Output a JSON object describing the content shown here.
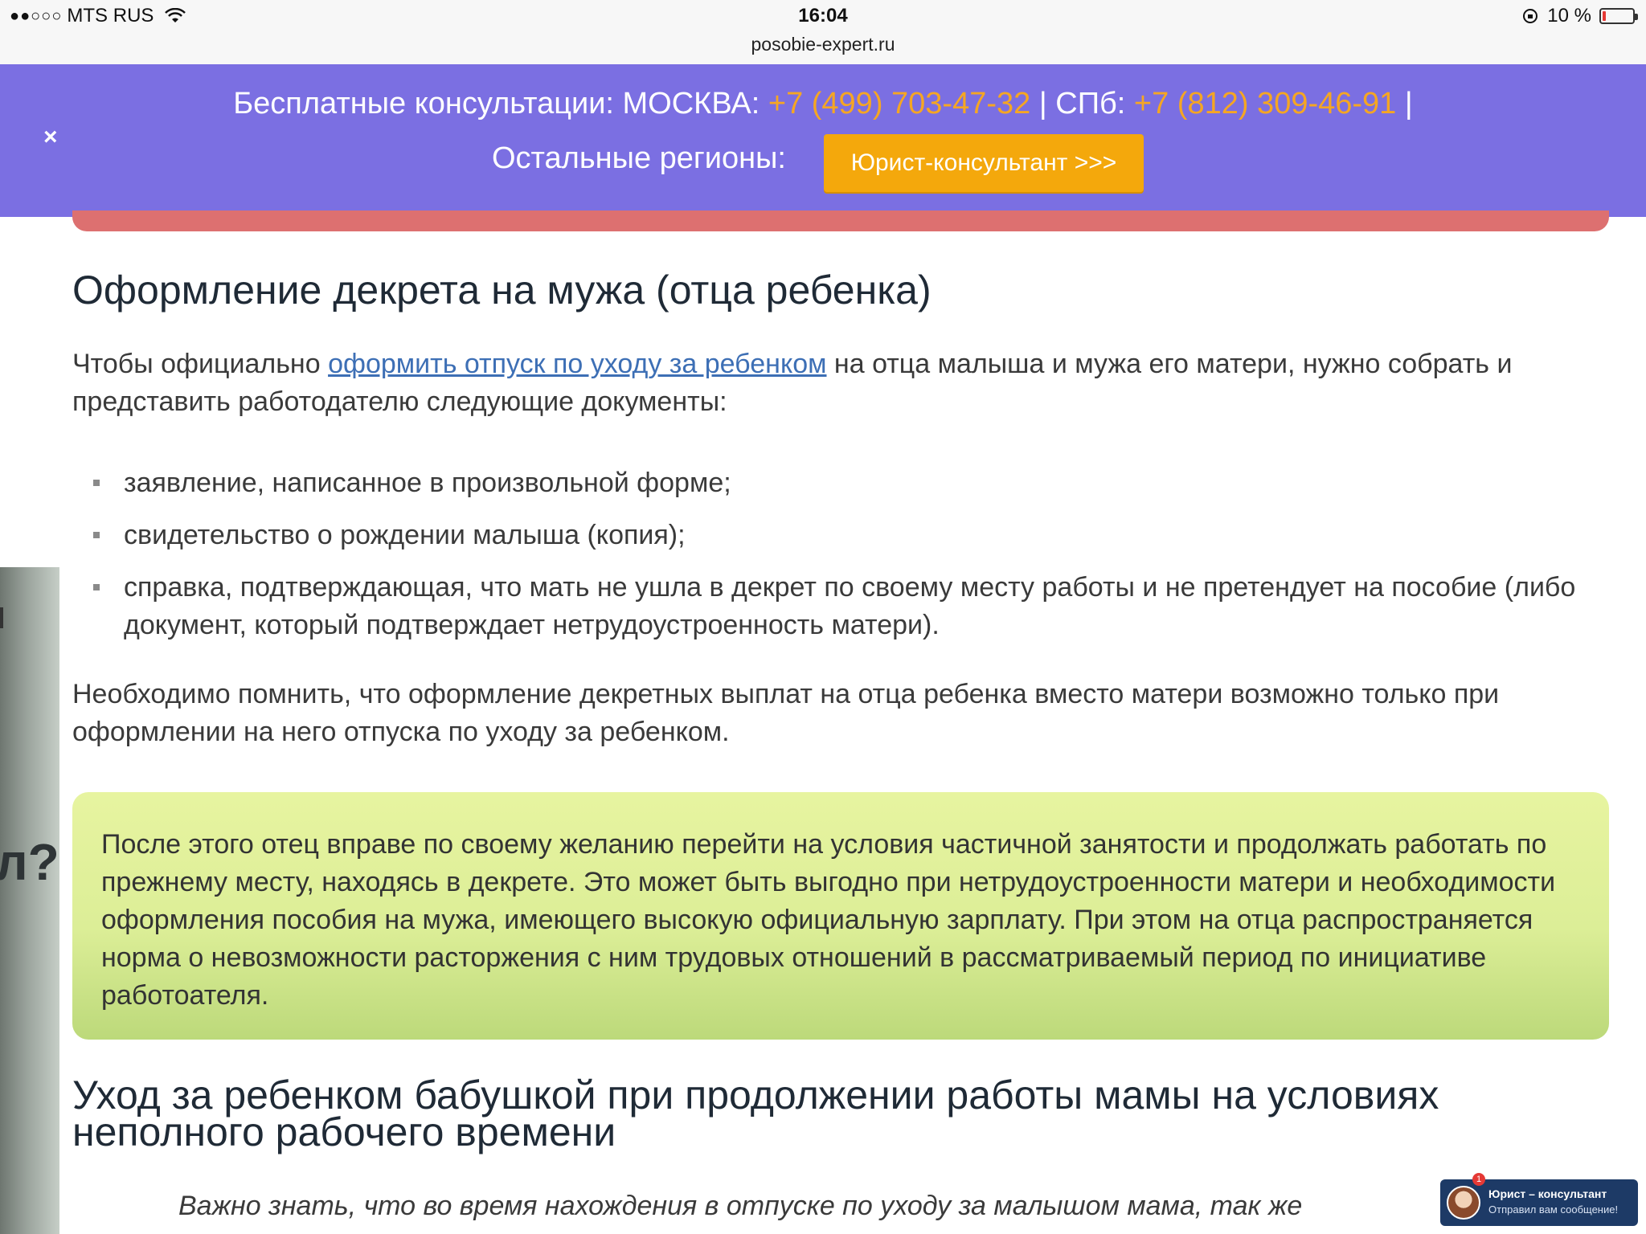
{
  "status_bar": {
    "carrier": "MTS RUS",
    "signal": "●●○○○",
    "time": "16:04",
    "url": "posobie-expert.ru",
    "battery": "10 %",
    "battery_level": 0.1
  },
  "banner": {
    "close": "×",
    "line1_prefix": "Бесплатные консультации: МОСКВА: ",
    "moscow_phone": "+7 (499) 703-47-32",
    "separator1": " | СПб: ",
    "spb_phone": "+7 (812) 309-46-91",
    "separator2": " |",
    "line2": "Остальные регионы:",
    "button": "Юрист-консультант >>>",
    "phone_color": "#f5a623",
    "background": "#7b6fe2",
    "button_color": "#f4a80c"
  },
  "side_edge": {
    "text": "л?"
  },
  "article": {
    "heading1": "Оформление декрета на мужа (отца ребенка)",
    "para1_prefix": "Чтобы официально ",
    "para1_link": "оформить отпуск по уходу за ребенком",
    "para1_suffix": " на отца малыша и мужа его матери, нужно собрать и представить работодателю следующие документы:",
    "list": [
      "заявление, написанное в произвольной форме;",
      "свидетельство о рождении малыша (копия);",
      "справка, подтверждающая, что мать не ушла в декрет по своему месту работы и не претендует на пособие (либо документ, который подтверждает нетрудоустроенность матери)."
    ],
    "para2": "Необходимо помнить, что оформление декретных выплат на отца ребенка вместо матери возможно только при оформлении на него отпуска по уходу за ребенком.",
    "callout": "После этого отец вправе по своему желанию перейти на условия частичной занятости и продолжать работать по прежнему месту, находясь в декрете. Это может быть выгодно при нетрудоустроенности матери и необходимости оформления пособия на мужа, имеющего высокую официальную зарплату. При этом на отца распространяется норма о невозможности расторжения с ним трудовых отношений в рассматриваемый период по инициативе работоателя.",
    "heading2": "Уход за ребенком бабушкой при продолжении работы мамы на условиях неполного рабочего времени",
    "quote": "Важно знать, что во время нахождения в отпуске по уходу за малышом мама, так же"
  },
  "chat_widget": {
    "badge": "1",
    "title": "Юрист – консультант",
    "subtitle": "Отправил вам сообщение!"
  }
}
